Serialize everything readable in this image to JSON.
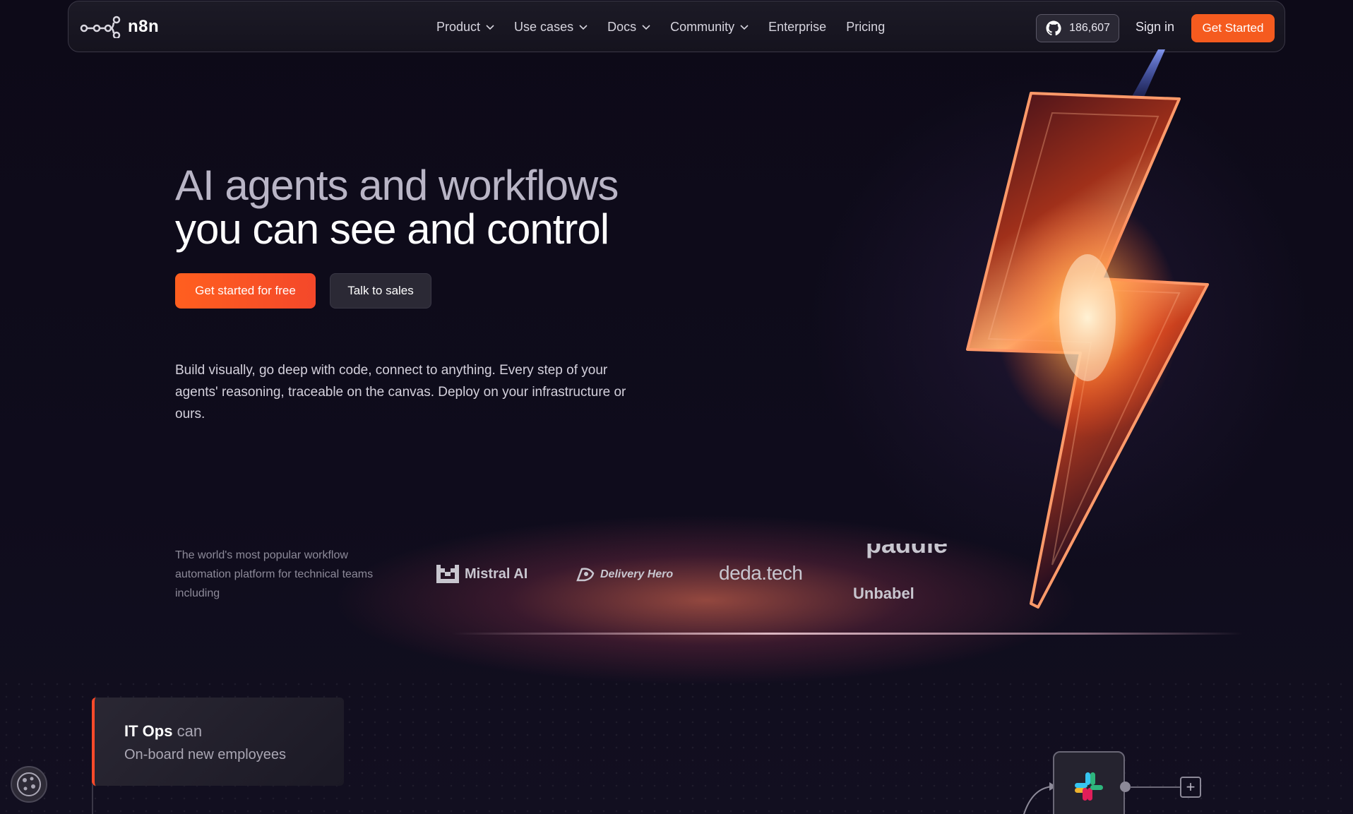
{
  "nav": {
    "logo_text": "n8n",
    "menu": [
      {
        "label": "Product",
        "dropdown": true
      },
      {
        "label": "Use cases",
        "dropdown": true
      },
      {
        "label": "Docs",
        "dropdown": true
      },
      {
        "label": "Community",
        "dropdown": true
      },
      {
        "label": "Enterprise",
        "dropdown": false
      },
      {
        "label": "Pricing",
        "dropdown": false
      }
    ],
    "github_stars": "186,607",
    "sign_in": "Sign in",
    "get_started": "Get Started"
  },
  "hero": {
    "headline_line1": "AI agents and workflows",
    "headline_line2": "you can see and control",
    "cta_primary": "Get started for free",
    "cta_secondary": "Talk to sales",
    "description": "Build visually, go deep with code, connect to anything. Every step of your agents' reasoning, traceable on the canvas. Deploy on your infrastructure or ours.",
    "trust_text": "The world's most popular workflow automation platform for technical teams including",
    "logos": [
      "Mistral AI",
      "Delivery Hero",
      "deda.tech",
      "paddle",
      "Unbabel"
    ]
  },
  "use_case": {
    "team": "IT Ops",
    "verb": "can",
    "task": "On-board new employees"
  },
  "colors": {
    "accent": "#f55b1f",
    "background": "#0e0b1a"
  }
}
